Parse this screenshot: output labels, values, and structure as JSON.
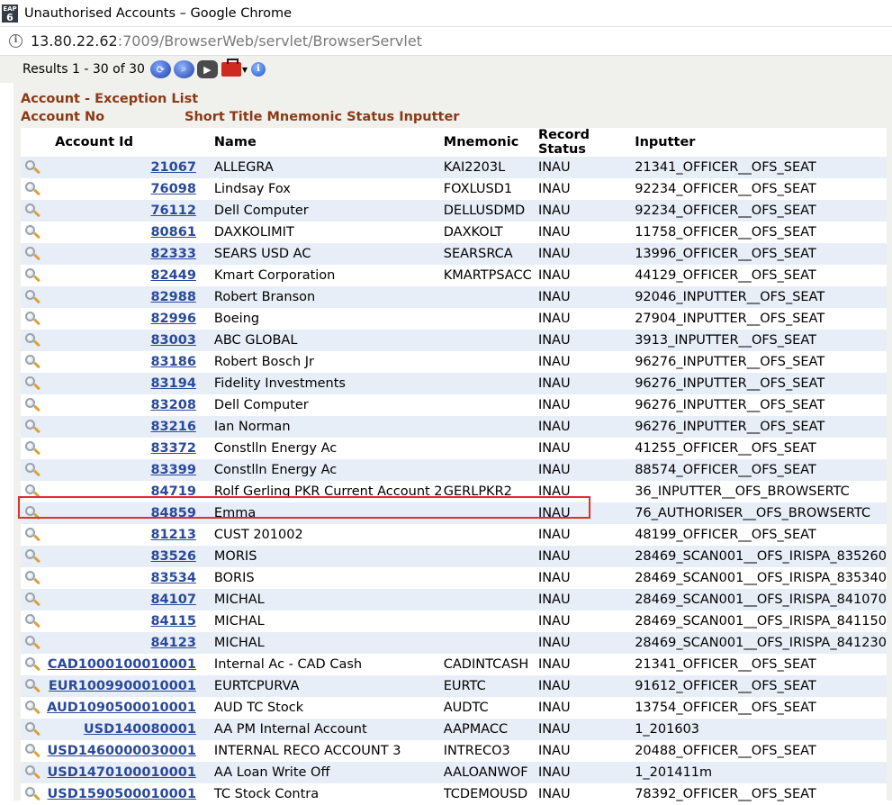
{
  "window": {
    "app_icon_top": "EAP",
    "app_icon_bottom": "6",
    "title": "Unauthorised Accounts – Google Chrome"
  },
  "address": {
    "host": "13.80.22.62",
    "path": ":7009/BrowserWeb/servlet/BrowserServlet"
  },
  "toolbar": {
    "results": "Results 1 - 30 of 30",
    "info_glyph": "i"
  },
  "page": {
    "heading": "Account - Exception List",
    "subheading_left": "Account No",
    "subheading_right": "Short Title Mnemonic Status Inputter"
  },
  "table": {
    "headers": [
      "Account Id",
      "Name",
      "Mnemonic",
      "Record Status",
      "Inputter"
    ],
    "rows": [
      {
        "id": "21067",
        "name": "ALLEGRA",
        "mnemonic": "KAI2203L",
        "status": "INAU",
        "inputter": "21341_OFFICER__OFS_SEAT"
      },
      {
        "id": "76098",
        "name": "Lindsay Fox",
        "mnemonic": "FOXLUSD1",
        "status": "INAU",
        "inputter": "92234_OFFICER__OFS_SEAT"
      },
      {
        "id": "76112",
        "name": "Dell Computer",
        "mnemonic": "DELLUSDMD",
        "status": "INAU",
        "inputter": "92234_OFFICER__OFS_SEAT"
      },
      {
        "id": "80861",
        "name": "DAXKOLIMIT",
        "mnemonic": "DAXKOLT",
        "status": "INAU",
        "inputter": "11758_OFFICER__OFS_SEAT"
      },
      {
        "id": "82333",
        "name": "SEARS USD AC",
        "mnemonic": "SEARSRCA",
        "status": "INAU",
        "inputter": "13996_OFFICER__OFS_SEAT"
      },
      {
        "id": "82449",
        "name": "Kmart Corporation",
        "mnemonic": "KMARTPSACC",
        "status": "INAU",
        "inputter": "44129_OFFICER__OFS_SEAT"
      },
      {
        "id": "82988",
        "name": "Robert Branson",
        "mnemonic": "",
        "status": "INAU",
        "inputter": "92046_INPUTTER__OFS_SEAT"
      },
      {
        "id": "82996",
        "name": "Boeing",
        "mnemonic": "",
        "status": "INAU",
        "inputter": "27904_INPUTTER__OFS_SEAT"
      },
      {
        "id": "83003",
        "name": "ABC GLOBAL",
        "mnemonic": "",
        "status": "INAU",
        "inputter": "3913_INPUTTER__OFS_SEAT"
      },
      {
        "id": "83186",
        "name": "Robert Bosch Jr",
        "mnemonic": "",
        "status": "INAU",
        "inputter": "96276_INPUTTER__OFS_SEAT"
      },
      {
        "id": "83194",
        "name": "Fidelity Investments",
        "mnemonic": "",
        "status": "INAU",
        "inputter": "96276_INPUTTER__OFS_SEAT"
      },
      {
        "id": "83208",
        "name": "Dell Computer",
        "mnemonic": "",
        "status": "INAU",
        "inputter": "96276_INPUTTER__OFS_SEAT"
      },
      {
        "id": "83216",
        "name": "Ian Norman",
        "mnemonic": "",
        "status": "INAU",
        "inputter": "96276_INPUTTER__OFS_SEAT"
      },
      {
        "id": "83372",
        "name": "Constlln Energy Ac",
        "mnemonic": "",
        "status": "INAU",
        "inputter": "41255_OFFICER__OFS_SEAT"
      },
      {
        "id": "83399",
        "name": "Constlln Energy Ac",
        "mnemonic": "",
        "status": "INAU",
        "inputter": "88574_OFFICER__OFS_SEAT"
      },
      {
        "id": "84719",
        "name": "Rolf Gerling PKR Current Account 2",
        "mnemonic": "GERLPKR2",
        "status": "INAU",
        "inputter": "36_INPUTTER__OFS_BROWSERTC"
      },
      {
        "id": "84859",
        "name": "Emma",
        "mnemonic": "",
        "status": "INAU",
        "inputter": "76_AUTHORISER__OFS_BROWSERTC"
      },
      {
        "id": "81213",
        "name": "CUST 201002",
        "mnemonic": "",
        "status": "INAU",
        "inputter": "48199_OFFICER__OFS_SEAT"
      },
      {
        "id": "83526",
        "name": "MORIS",
        "mnemonic": "",
        "status": "INAU",
        "inputter": "28469_SCAN001__OFS_IRISPA_835260"
      },
      {
        "id": "83534",
        "name": "BORIS",
        "mnemonic": "",
        "status": "INAU",
        "inputter": "28469_SCAN001__OFS_IRISPA_835340"
      },
      {
        "id": "84107",
        "name": "MICHAL",
        "mnemonic": "",
        "status": "INAU",
        "inputter": "28469_SCAN001__OFS_IRISPA_841070"
      },
      {
        "id": "84115",
        "name": "MICHAL",
        "mnemonic": "",
        "status": "INAU",
        "inputter": "28469_SCAN001__OFS_IRISPA_841150"
      },
      {
        "id": "84123",
        "name": "MICHAL",
        "mnemonic": "",
        "status": "INAU",
        "inputter": "28469_SCAN001__OFS_IRISPA_841230"
      },
      {
        "id": "CAD1000100010001",
        "name": "Internal Ac - CAD Cash",
        "mnemonic": "CADINTCASH",
        "status": "INAU",
        "inputter": "21341_OFFICER__OFS_SEAT"
      },
      {
        "id": "EUR1009900010001",
        "name": "EURTCPURVA",
        "mnemonic": "EURTC",
        "status": "INAU",
        "inputter": "91612_OFFICER__OFS_SEAT"
      },
      {
        "id": "AUD1090500010001",
        "name": "AUD TC Stock",
        "mnemonic": "AUDTC",
        "status": "INAU",
        "inputter": "13754_OFFICER__OFS_SEAT"
      },
      {
        "id": "USD140080001",
        "name": "AA PM Internal Account",
        "mnemonic": "AAPMACC",
        "status": "INAU",
        "inputter": "1_201603"
      },
      {
        "id": "USD1460000030001",
        "name": "INTERNAL RECO ACCOUNT 3",
        "mnemonic": "INTRECO3",
        "status": "INAU",
        "inputter": "20488_OFFICER__OFS_SEAT"
      },
      {
        "id": "USD1470100010001",
        "name": "AA Loan Write Off",
        "mnemonic": "AALOANWOF",
        "status": "INAU",
        "inputter": "1_201411m"
      },
      {
        "id": "USD1590500010001",
        "name": "TC Stock Contra",
        "mnemonic": "TCDEMOUSD",
        "status": "INAU",
        "inputter": "78392_OFFICER__OFS_SEAT"
      }
    ]
  },
  "colors": {
    "heading": "#8b3a16",
    "link": "#2a4a9a",
    "highlight_box": "#e0302a",
    "row_stripe": "#e8eef8"
  }
}
